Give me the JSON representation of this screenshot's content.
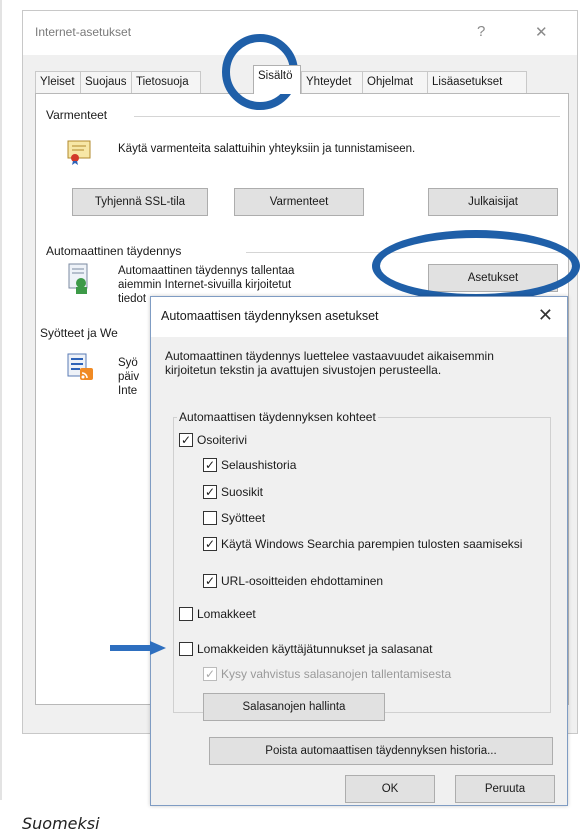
{
  "window": {
    "title": "Internet-asetukset",
    "help": "?",
    "close": "✕",
    "tabs": [
      "Yleiset",
      "Suojaus",
      "Tietosuoja",
      "Sisältö",
      "Yhteydet",
      "Ohjelmat",
      "Lisäasetukset"
    ],
    "active_tab": "Sisältö"
  },
  "certificates": {
    "heading": "Varmenteet",
    "description": "Käytä varmenteita salattuihin yhteyksiin ja tunnistamiseen.",
    "buttons": [
      "Tyhjennä SSL-tila",
      "Varmenteet",
      "Julkaisijat"
    ]
  },
  "autocomplete": {
    "heading": "Automaattinen täydennys",
    "description_lines": [
      "Automaattinen täydennys tallentaa",
      "aiemmin Internet-sivuilla kirjoitetut",
      "tiedot"
    ],
    "settings_button": "Asetukset"
  },
  "feeds": {
    "heading": "Syötteet ja We",
    "description_lines": [
      "Syö",
      "päiv",
      "Inte"
    ]
  },
  "dialog": {
    "title": "Automaattisen täydennyksen asetukset",
    "close": "✕",
    "description": "Automaattinen täydennys luettelee vastaavuudet aikaisemmin kirjoitetun tekstin ja avattujen sivustojen perusteella.",
    "group_title": "Automaattisen täydennyksen kohteet",
    "options": {
      "address_bar": {
        "label": "Osoiterivi",
        "checked": true
      },
      "history": {
        "label": "Selaushistoria",
        "checked": true
      },
      "favorites": {
        "label": "Suosikit",
        "checked": true
      },
      "feeds": {
        "label": "Syötteet",
        "checked": false
      },
      "windows_search": {
        "label": "Käytä Windows Searchia parempien tulosten saamiseksi",
        "checked": true
      },
      "url_suggest": {
        "label": "URL-osoitteiden ehdottaminen",
        "checked": true
      },
      "forms": {
        "label": "Lomakkeet",
        "checked": false
      },
      "usernames_passwords": {
        "label": "Lomakkeiden käyttäjätunnukset ja salasanat",
        "checked": false
      },
      "ask_confirm": {
        "label": "Kysy vahvistus salasanojen tallentamisesta",
        "checked": true,
        "disabled": true
      }
    },
    "manage_passwords_button": "Salasanojen hallinta",
    "delete_history_button": "Poista automaattisen täydennyksen historia...",
    "ok_button": "OK",
    "cancel_button": "Peruuta"
  },
  "caption": "Suomeksi",
  "colors": {
    "highlight": "#1f5fa8",
    "arrow": "#2e6fbf"
  }
}
